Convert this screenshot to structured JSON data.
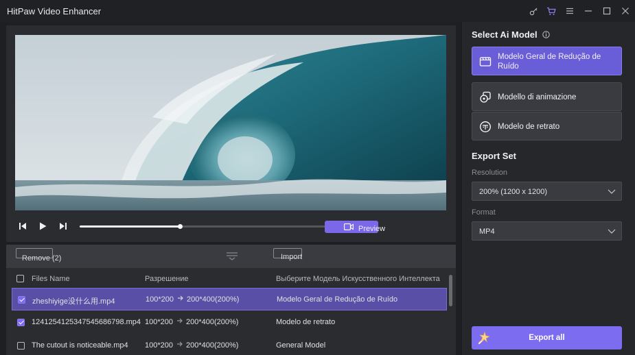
{
  "window": {
    "title": "HitPaw Video Enhancer",
    "controls": [
      "key-icon",
      "cart-icon",
      "menu-icon",
      "minimize-icon",
      "maximize-icon",
      "close-icon"
    ]
  },
  "player": {
    "progress": 0.34,
    "preview_label": "Preview"
  },
  "files_toolbar": {
    "remove_label": "Remove (2)",
    "import_label": "Import"
  },
  "file_table": {
    "headers": {
      "name": "Files Name",
      "resolution": "Разрешение",
      "model": "Выберите Модель Искусственного Интеллекта"
    },
    "rows": [
      {
        "checked": true,
        "selected": true,
        "name": "zheshiyige没什么用.mp4",
        "res_from": "100*200",
        "res_to": "200*400(200%)",
        "model": "Modelo Geral de Redução de Ruído"
      },
      {
        "checked": true,
        "selected": false,
        "name": "1241254125347545686798.mp4",
        "res_from": "100*200",
        "res_to": "200*400(200%)",
        "model": "Modelo de retrato"
      },
      {
        "checked": false,
        "selected": false,
        "name": "The cutout is noticeable.mp4",
        "res_from": "100*200",
        "res_to": "200*400(200%)",
        "model": "General Model"
      }
    ]
  },
  "right_panel": {
    "model_section_title": "Select Ai Model",
    "models": [
      {
        "label": "Modelo Geral de Redução de Ruído",
        "icon": "film-icon",
        "active": true
      },
      {
        "label": "Modello di animazione",
        "icon": "animation-icon",
        "active": false
      },
      {
        "label": "Modelo de retrato",
        "icon": "face-icon",
        "active": false
      }
    ],
    "export_section_title": "Export Set",
    "resolution_label": "Resolution",
    "resolution_value": "200% (1200 x 1200)",
    "format_label": "Format",
    "format_value": "MP4",
    "export_label": "Export all"
  },
  "colors": {
    "accent": "#7b6cf0",
    "selected_row": "#5a4fa6",
    "panel": "#26272b",
    "background": "#1e1f22"
  }
}
